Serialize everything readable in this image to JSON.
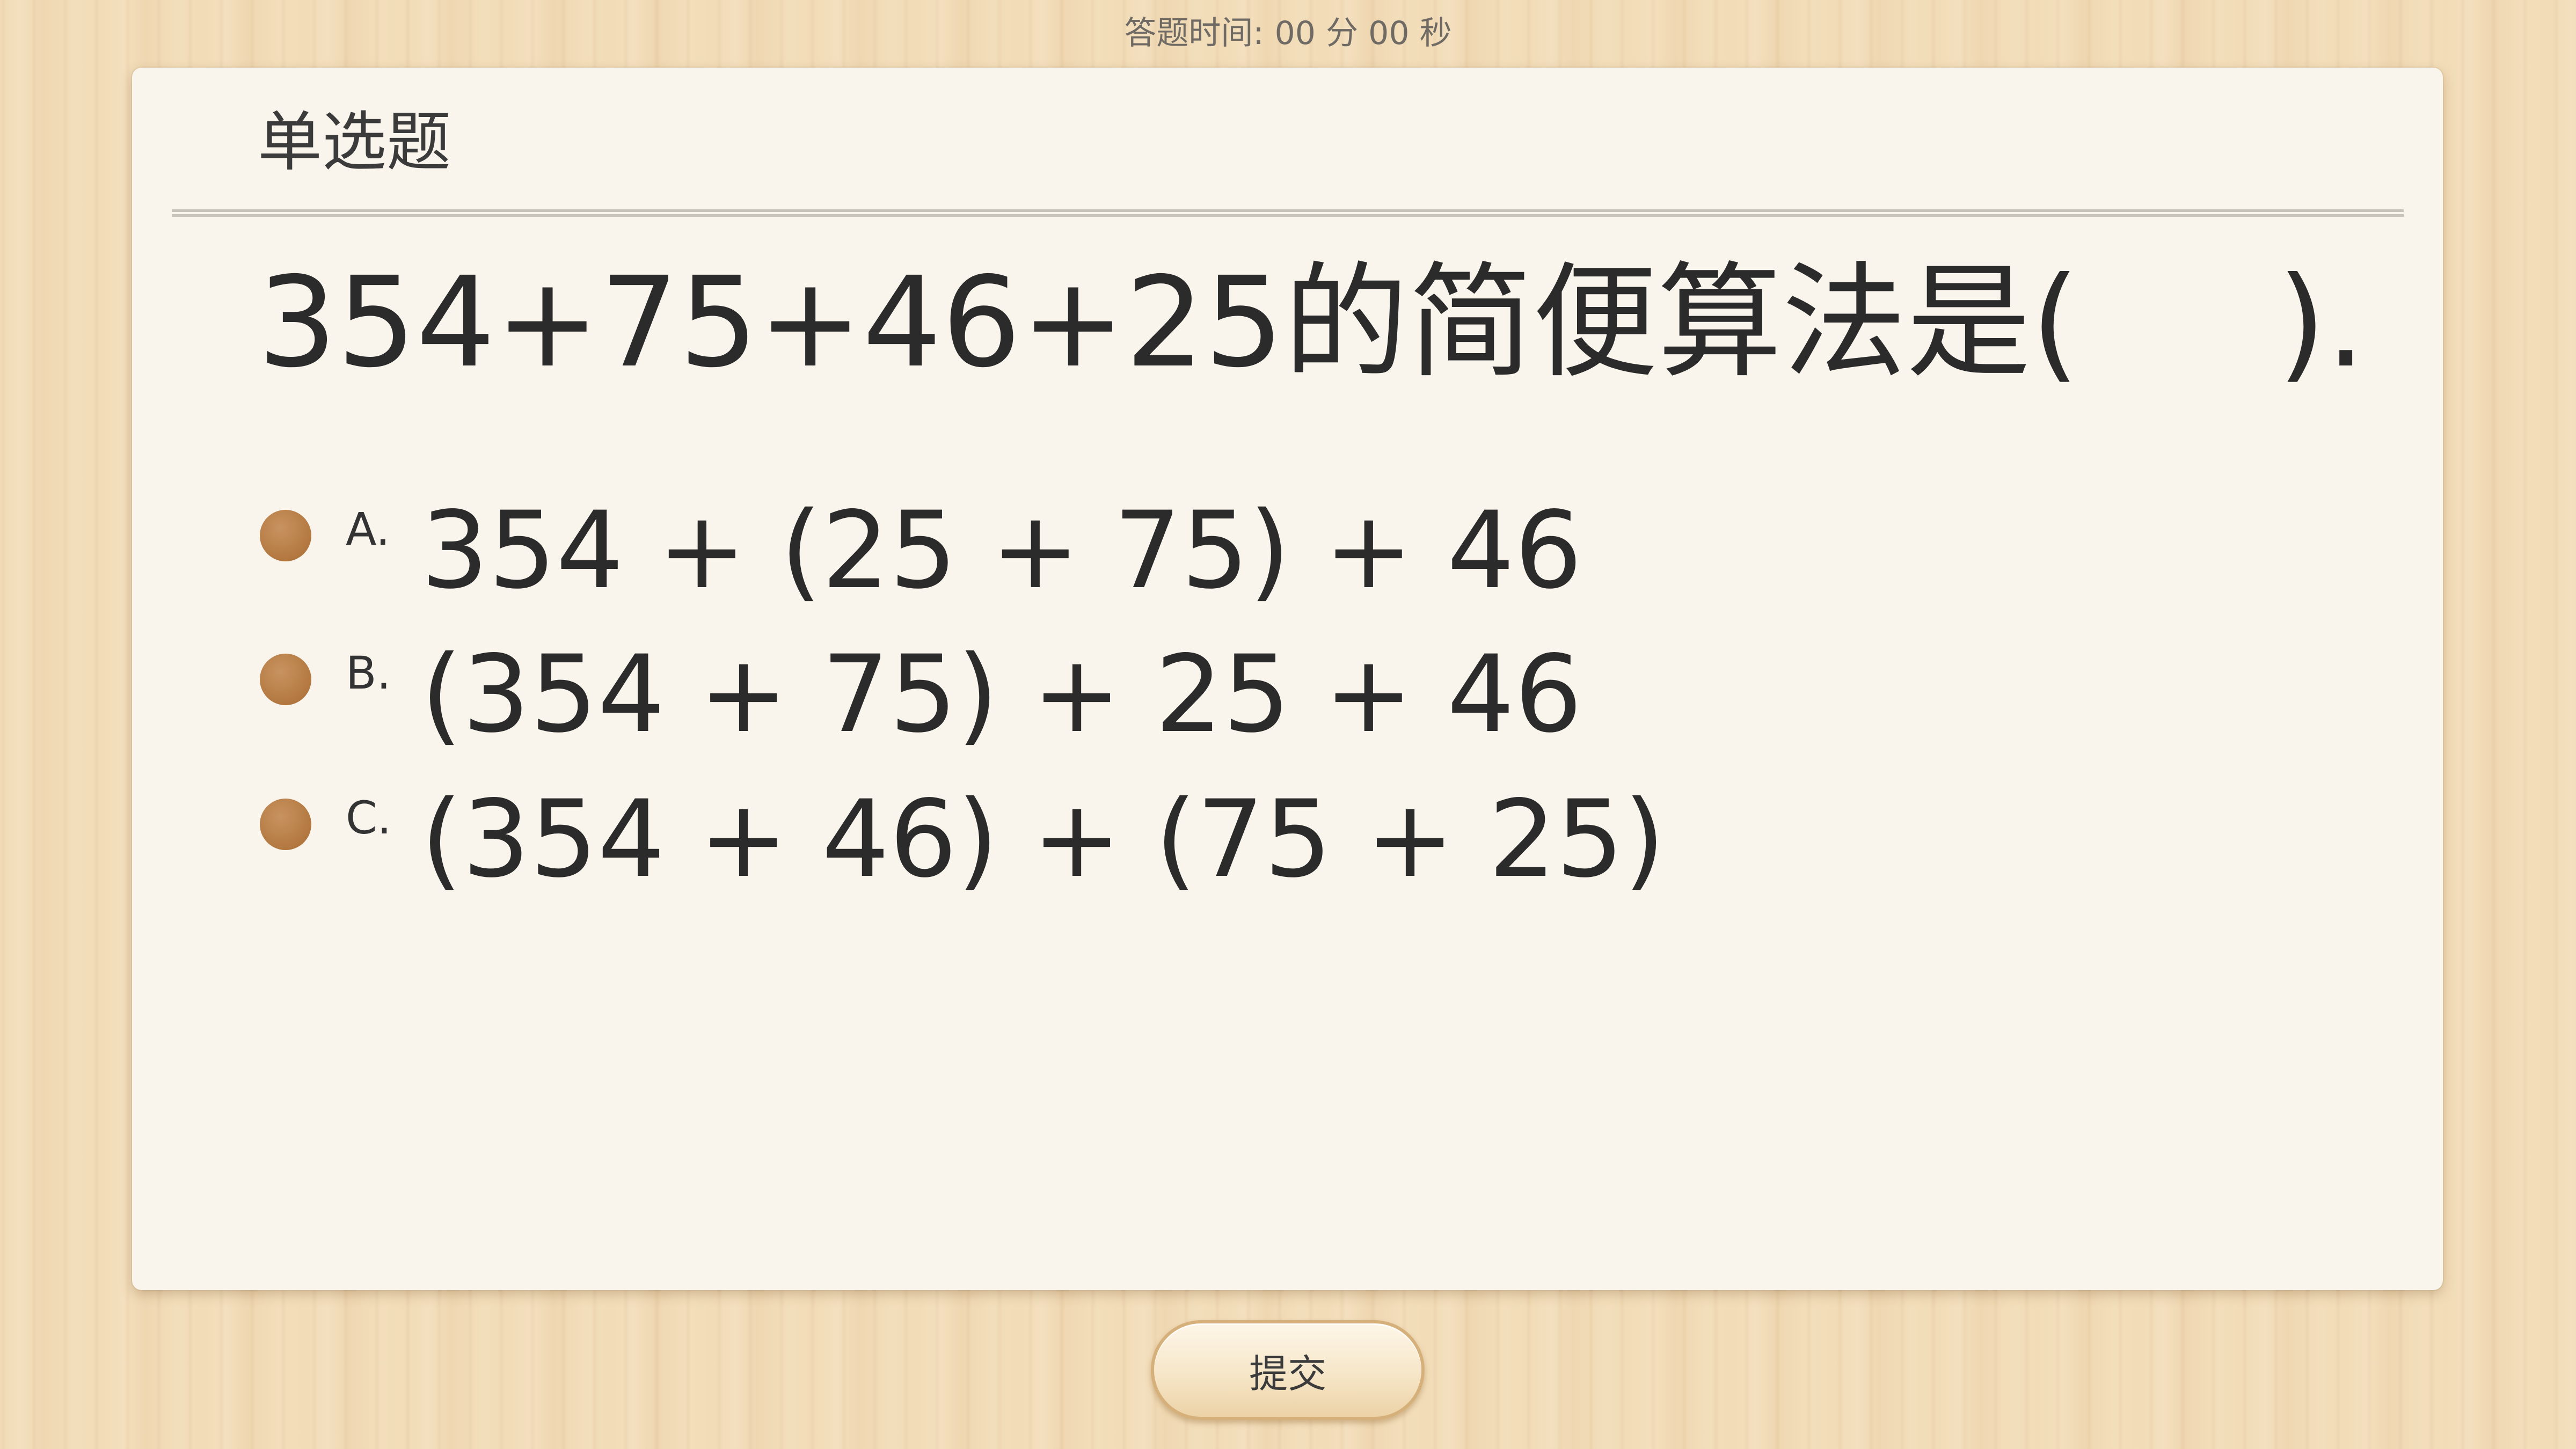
{
  "timer": {
    "label": "答题时间:",
    "minutes": "00",
    "minutes_unit": "分",
    "seconds": "00",
    "seconds_unit": "秒"
  },
  "question": {
    "type": "单选题",
    "text": "354+75+46+25的简便算法是(     ).",
    "options": [
      {
        "letter": "A.",
        "text": "354 + (25 + 75) + 46"
      },
      {
        "letter": "B.",
        "text": "(354 + 75) + 25 + 46"
      },
      {
        "letter": "C.",
        "text": "(354 + 46) + (75 + 25)"
      }
    ]
  },
  "submit": {
    "label": "提交"
  },
  "colors": {
    "radio_dot": "#b37840",
    "card_bg": "#f9f4ec",
    "wood_bg": "#f2dcb7"
  }
}
